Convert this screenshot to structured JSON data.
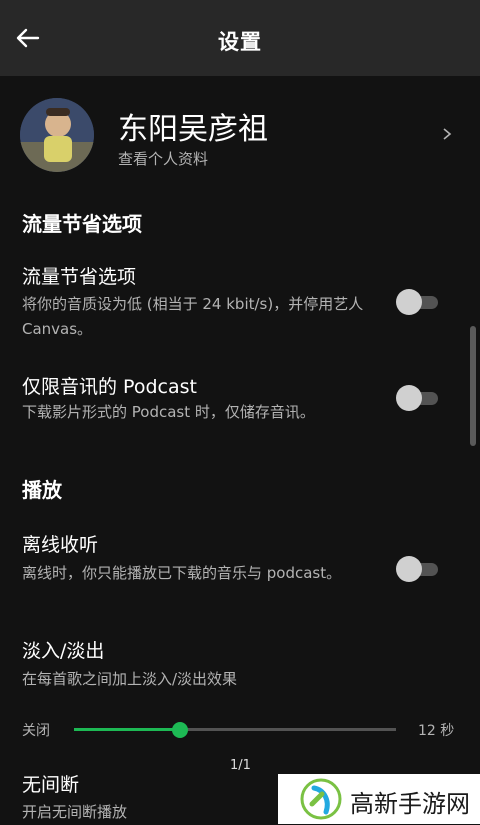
{
  "header": {
    "title": "设置"
  },
  "profile": {
    "name": "东阳吴彦祖",
    "subtitle": "查看个人资料"
  },
  "sections": {
    "data_saver": {
      "title": "流量节省选项",
      "items": [
        {
          "title": "流量节省选项",
          "desc": "将你的音质设为低 (相当于 24 kbit/s)，并停用艺人 Canvas。",
          "enabled": false
        },
        {
          "title": "仅限音讯的 Podcast",
          "desc": "下载影片形式的 Podcast 时，仅储存音讯。",
          "enabled": false
        }
      ]
    },
    "playback": {
      "title": "播放",
      "offline": {
        "title": "离线收听",
        "desc": "离线时，你只能播放已下载的音乐与 podcast。",
        "enabled": false
      },
      "crossfade": {
        "title": "淡入/淡出",
        "desc": "在每首歌之间加上淡入/淡出效果",
        "min_label": "关闭",
        "max_label": "12 秒",
        "value_fraction": 0.33
      },
      "gapless": {
        "title": "无间断",
        "desc": "开启无间断播放"
      }
    }
  },
  "page_counter": "1/1",
  "watermark": {
    "text": "高新手游网"
  },
  "colors": {
    "accent": "#1db954",
    "background": "#121212",
    "topbar": "#282828"
  }
}
